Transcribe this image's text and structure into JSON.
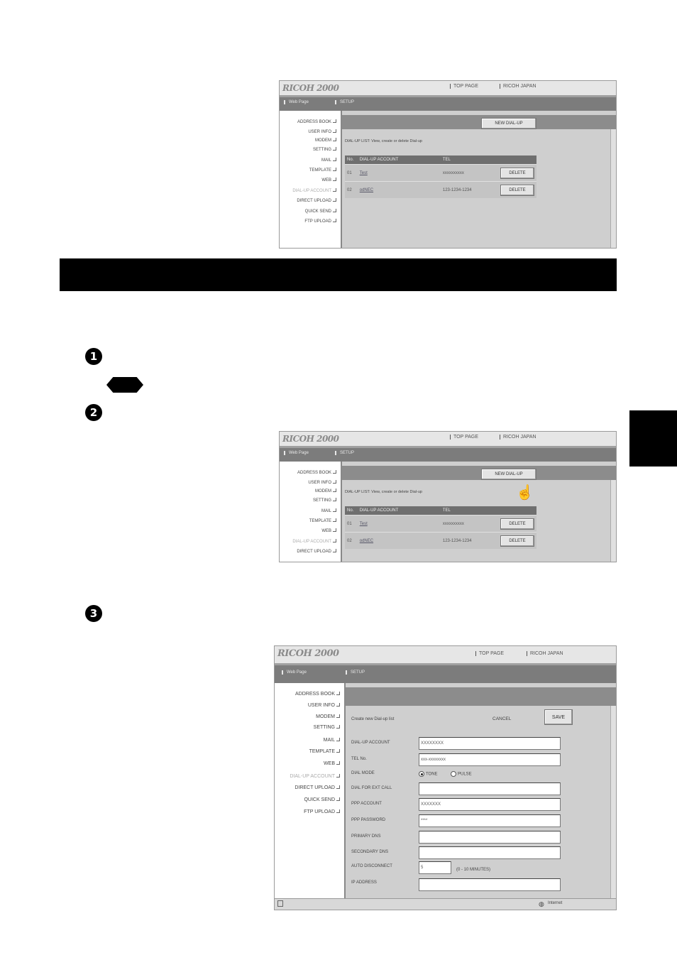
{
  "app": {
    "logo": "RICOH 2000",
    "top_links": [
      "TOP PAGE",
      "RICOH JAPAN"
    ],
    "tabs": [
      "Web Page",
      "SETUP"
    ],
    "nav_short": [
      "ADDRESS BOOK",
      "USER INFO",
      "MODEM",
      "SETTING",
      "MAIL",
      "TEMPLATE",
      "WEB",
      "DIAL-UP ACCOUNT",
      "DIRECT UPLOAD",
      "QUICK SEND",
      "FTP UPLOAD"
    ]
  },
  "list_view": {
    "new_button": "NEW DIAL-UP",
    "description": "DIAL-UP LIST: View, create or delete Dial-up",
    "columns": [
      "No.",
      "DIAL-UP ACCOUNT",
      "TEL",
      ""
    ],
    "rows": [
      {
        "no": "01",
        "account": "Test",
        "tel": "xxxxxxxxxx",
        "action": "DELETE"
      },
      {
        "no": "02",
        "account": "odNEC",
        "tel": "123-1234-1234",
        "action": "DELETE"
      }
    ]
  },
  "form_view": {
    "description": "Create new Dial-up list",
    "cancel": "CANCEL",
    "save": "SAVE",
    "fields": [
      {
        "label": "DIAL-UP ACCOUNT",
        "value": "XXXXXXXX"
      },
      {
        "label": "TEL No.",
        "value": "xxx-xxxxxxxx"
      },
      {
        "label": "DIAL MODE",
        "value": ""
      },
      {
        "label": "DIAL FOR EXT CALL",
        "value": ""
      },
      {
        "label": "PPP ACCOUNT",
        "value": "XXXXXXX"
      },
      {
        "label": "PPP PASSWORD",
        "value": "****"
      },
      {
        "label": "PRIMARY DNS",
        "value": ""
      },
      {
        "label": "SECONDARY DNS",
        "value": ""
      },
      {
        "label": "AUTO DISCONNECT",
        "value": "5"
      },
      {
        "label": "IP ADDRESS",
        "value": ""
      }
    ],
    "dial_mode_options": [
      "TONE",
      "PULSE"
    ],
    "auto_disconnect_hint": "(0 - 10 MINUTES)",
    "status_zone": "Internet"
  },
  "steps": [
    "1",
    "2",
    "3"
  ]
}
